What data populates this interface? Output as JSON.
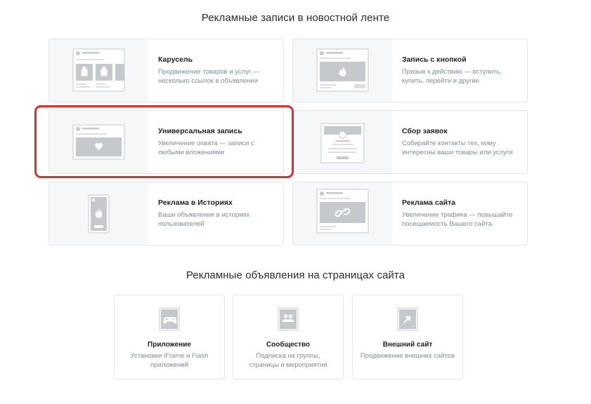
{
  "feed_section": {
    "title": "Рекламные записи в новостной ленте",
    "cards": [
      {
        "title": "Карусель",
        "desc": "Продвижение товаров и услуг — несколько ссылок в объявлении"
      },
      {
        "title": "Запись с кнопкой",
        "desc": "Призыв к действию — вступить, купить, перейти и другие"
      },
      {
        "title": "Универсальная запись",
        "desc": "Увеличение охвата — записи с любыми вложениями"
      },
      {
        "title": "Сбор заявок",
        "desc": "Собирайте контакты тех, кому интересны ваши товары или услуги"
      },
      {
        "title": "Реклама в Историях",
        "desc": "Ваши объявления в историях пользователей"
      },
      {
        "title": "Реклама сайта",
        "desc": "Увеличение трафика — повышайте посещаемость Вашего сайта"
      }
    ]
  },
  "site_section": {
    "title": "Рекламные объявления на страницах сайта",
    "cards": [
      {
        "title": "Приложение",
        "desc": "Установки iFrame и Flash приложений"
      },
      {
        "title": "Сообщество",
        "desc": "Подписка на группы, страницы и мероприятия"
      },
      {
        "title": "Внешний сайт",
        "desc": "Продвижение внешних сайтов"
      }
    ]
  },
  "colors": {
    "highlight": "#e02e2e",
    "placeholder": "#c5c8cc",
    "muted_text": "#818c99"
  }
}
